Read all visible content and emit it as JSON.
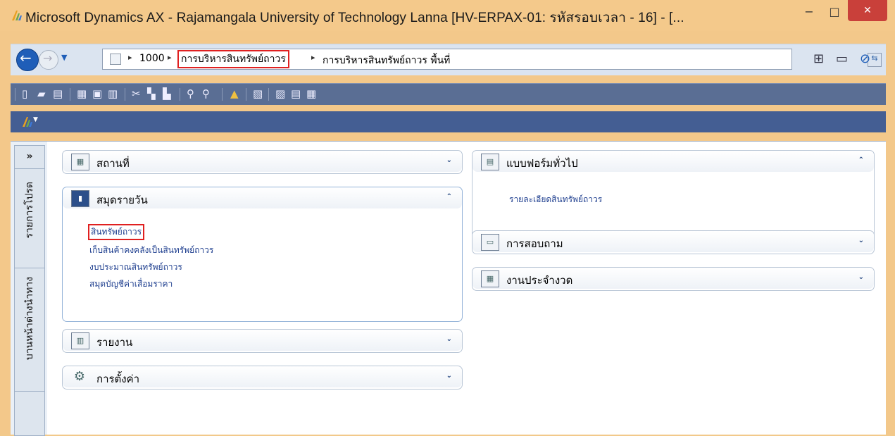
{
  "window": {
    "title": "Microsoft Dynamics AX - Rajamangala University of Technology Lanna [HV-ERPAX-01: รหัสรอบเวลา - 16] - [...",
    "minimize_glyph": "−",
    "maximize_glyph": "□",
    "close_glyph": "✕"
  },
  "address": {
    "crumbs": [
      "1000",
      "การบริหารสินทรัพย์ถาวร",
      "การบริหารสินทรัพย์ถาวร พื้นที่"
    ],
    "separator": "▸"
  },
  "nav_pane": {
    "expand_glyph": "»",
    "tabs": [
      "รายการโปรด",
      "บานหน้าต่างนำทาง"
    ]
  },
  "panels": {
    "location": {
      "title": "สถานที่",
      "chevron": "⌄"
    },
    "journals": {
      "title": "สมุดรายวัน",
      "chevron": "⌃",
      "links": [
        "สินทรัพย์ถาวร",
        "เก็บสินค้าคงคลังเป็นสินทรัพย์ถาวร",
        "งบประมาณสินทรัพย์ถาวร",
        "สมุดบัญชีค่าเสื่อมราคา"
      ]
    },
    "reports": {
      "title": "รายงาน",
      "chevron": "⌄"
    },
    "settings": {
      "title": "การตั้งค่า",
      "chevron": "⌄"
    },
    "common_forms": {
      "title": "แบบฟอร์มทั่วไป",
      "chevron": "⌃",
      "links": [
        "รายละเอียดสินทรัพย์ถาวร"
      ]
    },
    "inquiries": {
      "title": "การสอบถาม",
      "chevron": "⌄"
    },
    "periodic": {
      "title": "งานประจำงวด",
      "chevron": "⌄"
    }
  },
  "colors": {
    "accent_red": "#e02020",
    "toolbar": "#5a6e94",
    "title_bar": "#f4c98b",
    "link": "#1f3f8f"
  }
}
